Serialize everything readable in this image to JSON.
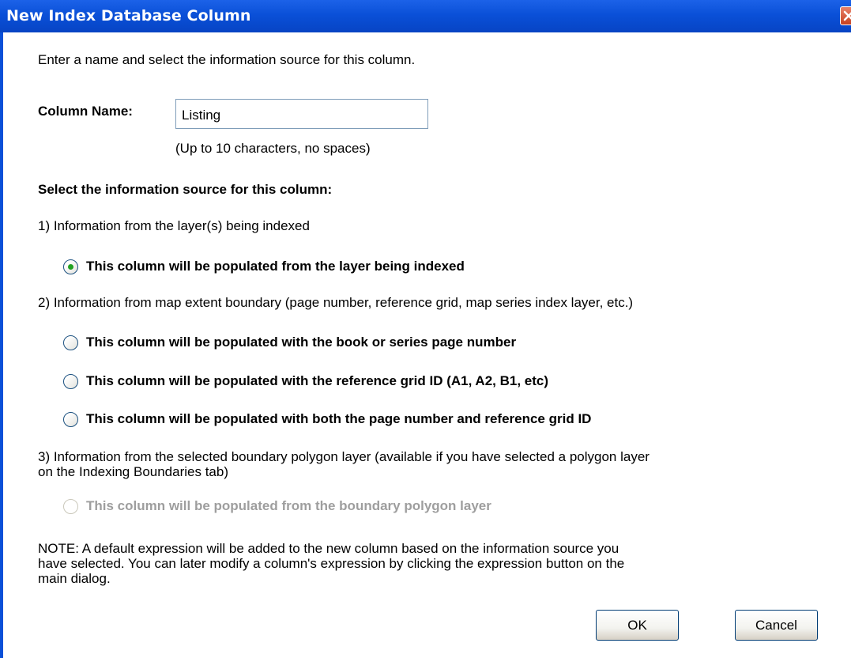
{
  "window": {
    "title": "New Index Database Column",
    "close_icon": "close-icon"
  },
  "intro": "Enter a name and select the information source for this column.",
  "column_name": {
    "label": "Column Name:",
    "value": "Listing",
    "hint": "(Up to 10 characters, no spaces)"
  },
  "source_heading": "Select the information source for this column:",
  "sections": {
    "layer": {
      "heading": "1) Information from the layer(s) being indexed",
      "options": [
        "This column will be populated from the layer being indexed"
      ]
    },
    "extent": {
      "heading": "2) Information from map extent boundary (page number, reference grid, map series index layer, etc.)",
      "options": [
        "This column will be populated with the book or series page number",
        "This column will be populated with the reference grid ID (A1, A2, B1, etc)",
        "This column will be populated with both the page number and reference grid ID"
      ]
    },
    "boundary": {
      "heading": "3) Information from the selected boundary polygon layer (available if you have selected a polygon layer\non the Indexing Boundaries tab)",
      "options": [
        "This column will be populated from the boundary polygon layer"
      ]
    }
  },
  "selected_option": "This column will be populated from the layer being indexed",
  "note": "NOTE: A default expression will be added to the new column based on the information source you\nhave selected.  You can later modify a column's expression by clicking the expression button on the\nmain dialog.",
  "buttons": {
    "ok": "OK",
    "cancel": "Cancel"
  }
}
